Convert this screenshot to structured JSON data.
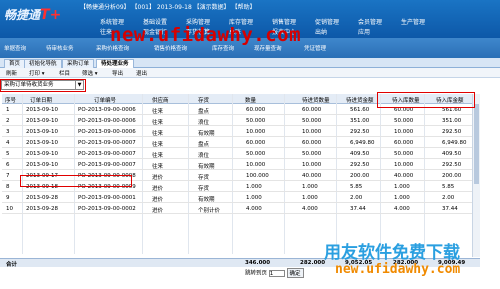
{
  "header": {
    "brand": "畅捷通",
    "brand_mark": "T+",
    "topinfo": "【畅捷通分析09】 【001】 2013-09-18 【演示数据】 【帮助】",
    "menu": [
      "系统管理",
      "基础设置",
      "采购管理",
      "库存管理",
      "销售管理",
      "促销管理",
      "会员管理",
      "生产管理",
      "往来",
      "现金银行",
      "存货核算",
      "总账",
      "报表中心",
      "出纳",
      "应用"
    ]
  },
  "watermark_url": "new.ufidawhy.com",
  "subnav": [
    "单据查询",
    "待审核业务",
    "采购价格查询",
    "销售价格查询",
    "库存查询",
    "现存量查询",
    "凭证管理"
  ],
  "tabs": [
    "首页",
    "初始化导航",
    "采购订单",
    "待处理业务"
  ],
  "toolbar": [
    "刷新",
    "打印 ▾",
    "栏目",
    "筛选 ▾",
    "导出",
    "退出"
  ],
  "filter": {
    "value": "采购订单待收货业务"
  },
  "grid": {
    "columns": [
      "序号",
      "订单日期",
      "订单编号",
      "供应商",
      "存货",
      "数量",
      "待进货数量",
      "待进货金额",
      "待入库数量",
      "待入库金额"
    ],
    "rows": [
      {
        "no": "1",
        "date": "2013-09-10",
        "code": "PO-2013-09-00-0006",
        "vendor": "往来",
        "item": "盘点",
        "qty": "60.000",
        "pend_qty": "60.000",
        "pend_amt": "561.60",
        "in_qty": "60.000",
        "in_amt": "561.60"
      },
      {
        "no": "2",
        "date": "2013-09-10",
        "code": "PO-2013-09-00-0006",
        "vendor": "往来",
        "item": "浪位",
        "qty": "50.000",
        "pend_qty": "50.000",
        "pend_amt": "351.00",
        "in_qty": "50.000",
        "in_amt": "351.00"
      },
      {
        "no": "3",
        "date": "2013-09-10",
        "code": "PO-2013-09-00-0006",
        "vendor": "往来",
        "item": "有效期",
        "qty": "10.000",
        "pend_qty": "10.000",
        "pend_amt": "292.50",
        "in_qty": "10.000",
        "in_amt": "292.50"
      },
      {
        "no": "4",
        "date": "2013-09-10",
        "code": "PO-2013-09-00-0007",
        "vendor": "往来",
        "item": "盘点",
        "qty": "60.000",
        "pend_qty": "60.000",
        "pend_amt": "6,949.80",
        "in_qty": "60.000",
        "in_amt": "6,949.80"
      },
      {
        "no": "5",
        "date": "2013-09-10",
        "code": "PO-2013-09-00-0007",
        "vendor": "往来",
        "item": "浪位",
        "qty": "50.000",
        "pend_qty": "50.000",
        "pend_amt": "409.50",
        "in_qty": "50.000",
        "in_amt": "409.50"
      },
      {
        "no": "6",
        "date": "2013-09-10",
        "code": "PO-2013-09-00-0007",
        "vendor": "往来",
        "item": "有效期",
        "qty": "10.000",
        "pend_qty": "10.000",
        "pend_amt": "292.50",
        "in_qty": "10.000",
        "in_amt": "292.50"
      },
      {
        "no": "7",
        "date": "2013-09-17",
        "code": "PO-2013-09-00-0008",
        "vendor": "进价",
        "item": "存货",
        "qty": "100.000",
        "pend_qty": "40.000",
        "pend_amt": "200.00",
        "in_qty": "40.000",
        "in_amt": "200.00"
      },
      {
        "no": "8",
        "date": "2013-09-18",
        "code": "PO-2013-09-00-0009",
        "vendor": "进价",
        "item": "存货",
        "qty": "1.000",
        "pend_qty": "1.000",
        "pend_amt": "5.85",
        "in_qty": "1.000",
        "in_amt": "5.85"
      },
      {
        "no": "9",
        "date": "2013-09-28",
        "code": "PO-2013-09-00-0001",
        "vendor": "进价",
        "item": "有效期",
        "qty": "1.000",
        "pend_qty": "1.000",
        "pend_amt": "2.00",
        "in_qty": "1.000",
        "in_amt": "2.00"
      },
      {
        "no": "10",
        "date": "2013-09-28",
        "code": "PO-2013-09-00-0002",
        "vendor": "进价",
        "item": "个别计价",
        "qty": "4.000",
        "pend_qty": "4.000",
        "pend_amt": "37.44",
        "in_qty": "4.000",
        "in_amt": "37.44"
      }
    ]
  },
  "total": {
    "label": "合计",
    "qty": "346.000",
    "pend_qty": "282.000",
    "pend_amt": "9,052.05",
    "in_qty": "282.000",
    "in_amt": "9,009.49"
  },
  "pager": {
    "goto_label": "跳转到页",
    "page_value": "1",
    "confirm_label": "确定"
  },
  "watermark": {
    "line1": "用友软件免费下载",
    "line2": "new.ufidawhy.com"
  },
  "colors": {
    "header_bg": "#0d58a8",
    "highlight_box": "#e00000",
    "watermark_blue": "#2a9fe0",
    "watermark_orange": "#f08a00"
  }
}
